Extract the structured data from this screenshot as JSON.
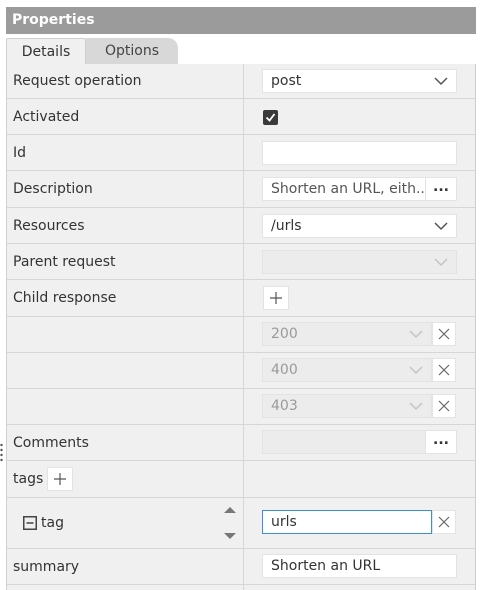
{
  "panel": {
    "title": "Properties"
  },
  "tabs": [
    {
      "label": "Details"
    },
    {
      "label": "Options"
    }
  ],
  "rows": {
    "request_operation": {
      "label": "Request operation",
      "value": "post"
    },
    "activated": {
      "label": "Activated",
      "checked": true
    },
    "id": {
      "label": "Id",
      "value": ""
    },
    "description": {
      "label": "Description",
      "value": "Shorten an URL, eith...",
      "more": "..."
    },
    "resources": {
      "label": "Resources",
      "value": "/urls"
    },
    "parent_request": {
      "label": "Parent request",
      "value": ""
    },
    "child_response": {
      "label": "Child response",
      "items": [
        "200",
        "400",
        "403"
      ]
    },
    "comments": {
      "label": "Comments",
      "value": "",
      "more": "..."
    },
    "tags": {
      "label": "tags"
    },
    "tag": {
      "label": "tag",
      "value": "urls"
    },
    "summary": {
      "label": "summary",
      "value": "Shorten an URL"
    }
  },
  "icons": {
    "dropdown": "chevron-down-icon",
    "remove": "close-icon",
    "add": "plus-icon",
    "collapse": "minus-box-icon",
    "sort": "sort-arrows-icon",
    "check": "checkmark-icon"
  },
  "colors": {
    "header_bg": "#9b9b9b",
    "panel_bg": "#f0f0f0",
    "focus_border": "#3b8fd4"
  }
}
